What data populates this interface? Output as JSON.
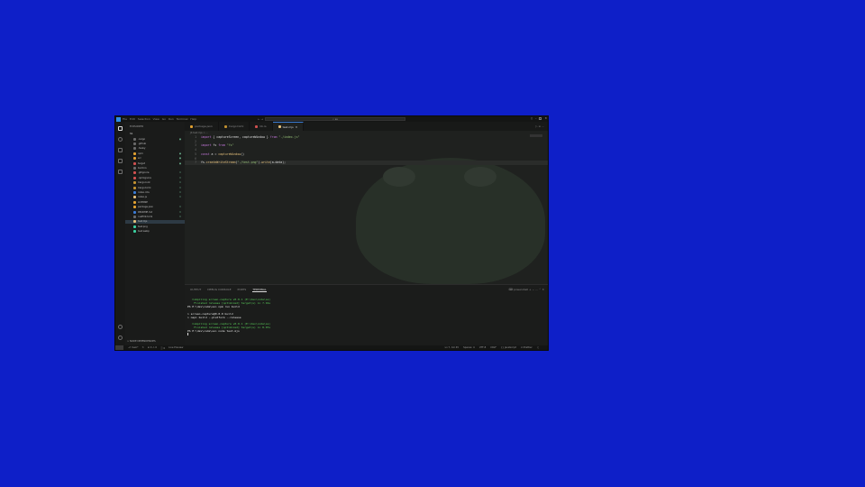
{
  "titlebar": {
    "menu": [
      "File",
      "Edit",
      "Selection",
      "View",
      "Go",
      "Run",
      "Terminal",
      "Help"
    ],
    "nav": "← →",
    "search": "⌕ ss"
  },
  "sidebar": {
    "header": "EXPLORER",
    "root": "SS",
    "items": [
      {
        "label": ".cargo",
        "color": "#6a6a6a",
        "mark": "●"
      },
      {
        "label": ".github",
        "color": "#6a6a6a",
        "mark": ""
      },
      {
        "label": ".husky",
        "color": "#6a6a6a",
        "mark": ""
      },
      {
        "label": "npm",
        "color": "#e0a030",
        "mark": "●"
      },
      {
        "label": "src",
        "color": "#e0a030",
        "mark": "●"
      },
      {
        "label": "target",
        "color": "#d05050",
        "mark": "●"
      },
      {
        "label": "build.rs",
        "color": "#6a6a6a",
        "mark": ""
      },
      {
        "label": ".gitignore",
        "color": "#d05050",
        "mark": "U"
      },
      {
        "label": ".npmignore",
        "color": "#d05050",
        "mark": "U"
      },
      {
        "label": "Cargo.lock",
        "color": "#c09030",
        "mark": "U"
      },
      {
        "label": "Cargo.toml",
        "color": "#c09030",
        "mark": "U"
      },
      {
        "label": "index.d.ts",
        "color": "#3a7bd5",
        "mark": "U"
      },
      {
        "label": "index.js",
        "color": "#e5c07b",
        "mark": "U"
      },
      {
        "label": "LICENSE",
        "color": "#e0a030",
        "mark": ""
      },
      {
        "label": "package.json",
        "color": "#e0a030",
        "mark": "U"
      },
      {
        "label": "README.md",
        "color": "#3a7bd5",
        "mark": "U"
      },
      {
        "label": "rustfmt.toml",
        "color": "#6a6a6a",
        "mark": "U"
      },
      {
        "label": "test.mjs",
        "color": "#e5c07b",
        "mark": "U",
        "selected": true
      },
      {
        "label": "test.png",
        "color": "#3ad0a0",
        "mark": ""
      },
      {
        "label": "test.webp",
        "color": "#3ad0a0",
        "mark": ""
      }
    ],
    "bottom": "> NODE DEPENDENCIES"
  },
  "tabs": [
    {
      "label": "package.json",
      "color": "#e0a030",
      "active": false
    },
    {
      "label": "Cargo.toml",
      "color": "#c09030",
      "active": false
    },
    {
      "label": "lib.rs",
      "color": "#d05050",
      "active": false
    },
    {
      "label": "test.mjs",
      "color": "#e5c07b",
      "active": true
    }
  ],
  "tab_actions": "▷ ≡ ⋯",
  "breadcrumb": "JS test.mjs > ...",
  "code": [
    {
      "n": "1",
      "parts": [
        [
          "kw",
          "import"
        ],
        [
          "vr",
          " { captureScreen, captureWindow } "
        ],
        [
          "kw",
          "from"
        ],
        [
          "str",
          " \"./index.js\""
        ]
      ]
    },
    {
      "n": "2",
      "parts": []
    },
    {
      "n": "3",
      "parts": [
        [
          "kw",
          "import"
        ],
        [
          "vr",
          " fs "
        ],
        [
          "kw",
          "from"
        ],
        [
          "str",
          " \"fs\""
        ]
      ]
    },
    {
      "n": "4",
      "parts": []
    },
    {
      "n": "5",
      "parts": [
        [
          "kw",
          "const"
        ],
        [
          "vr",
          " a = "
        ],
        [
          "fn",
          "captureWindow"
        ],
        [
          "vr",
          "()"
        ]
      ]
    },
    {
      "n": "6",
      "parts": []
    },
    {
      "n": "7",
      "parts": [
        [
          "vr",
          "fs."
        ],
        [
          "fn",
          "createWriteStream"
        ],
        [
          "vr",
          "("
        ],
        [
          "str",
          "\"./test.png\""
        ],
        [
          "vr",
          ")."
        ],
        [
          "fn",
          "write"
        ],
        [
          "vr",
          "(a.data);"
        ]
      ],
      "current": true
    }
  ],
  "panel": {
    "tabs": [
      "OUTPUT",
      "DEBUG CONSOLE",
      "PORTS",
      "TERMINAL"
    ],
    "active": "TERMINAL",
    "actions": "⌨ powershell + ⌄ ⋯ ⌃ ✕"
  },
  "terminal": [
    {
      "t": "   Compiling screen-capture v0.0.1 (E:\\dev\\code\\ss)",
      "c": "green"
    },
    {
      "t": "    Finished release [optimized] target(s) in 7.91s",
      "c": "green"
    },
    {
      "t": "PS E:\\dev\\code\\ss> npm run build",
      "c": "bold"
    },
    {
      "t": "",
      "c": ""
    },
    {
      "t": "> screen-capture@0.0.0 build",
      "c": "bold"
    },
    {
      "t": "> napi build --platform --release",
      "c": "bold"
    },
    {
      "t": "",
      "c": ""
    },
    {
      "t": "   Compiling screen-capture v0.0.1 (E:\\dev\\code\\ss)",
      "c": "green"
    },
    {
      "t": "    Finished release [optimized] target(s) in 8.07s",
      "c": "green"
    },
    {
      "t": "PS E:\\dev\\code\\ss> node test.mjs",
      "c": "bold"
    },
    {
      "t": "",
      "c": ""
    }
  ],
  "status": {
    "left": [
      "⎇ main*",
      "↻",
      "⊗ 0 ⚠ 0",
      "ⓘ 0",
      "Live Preview"
    ],
    "right": [
      "Ln 7, Col 45",
      "Spaces: 4",
      "UTF-8",
      "CRLF",
      "{} JavaScript",
      "☑ Prettier",
      "♫"
    ]
  }
}
